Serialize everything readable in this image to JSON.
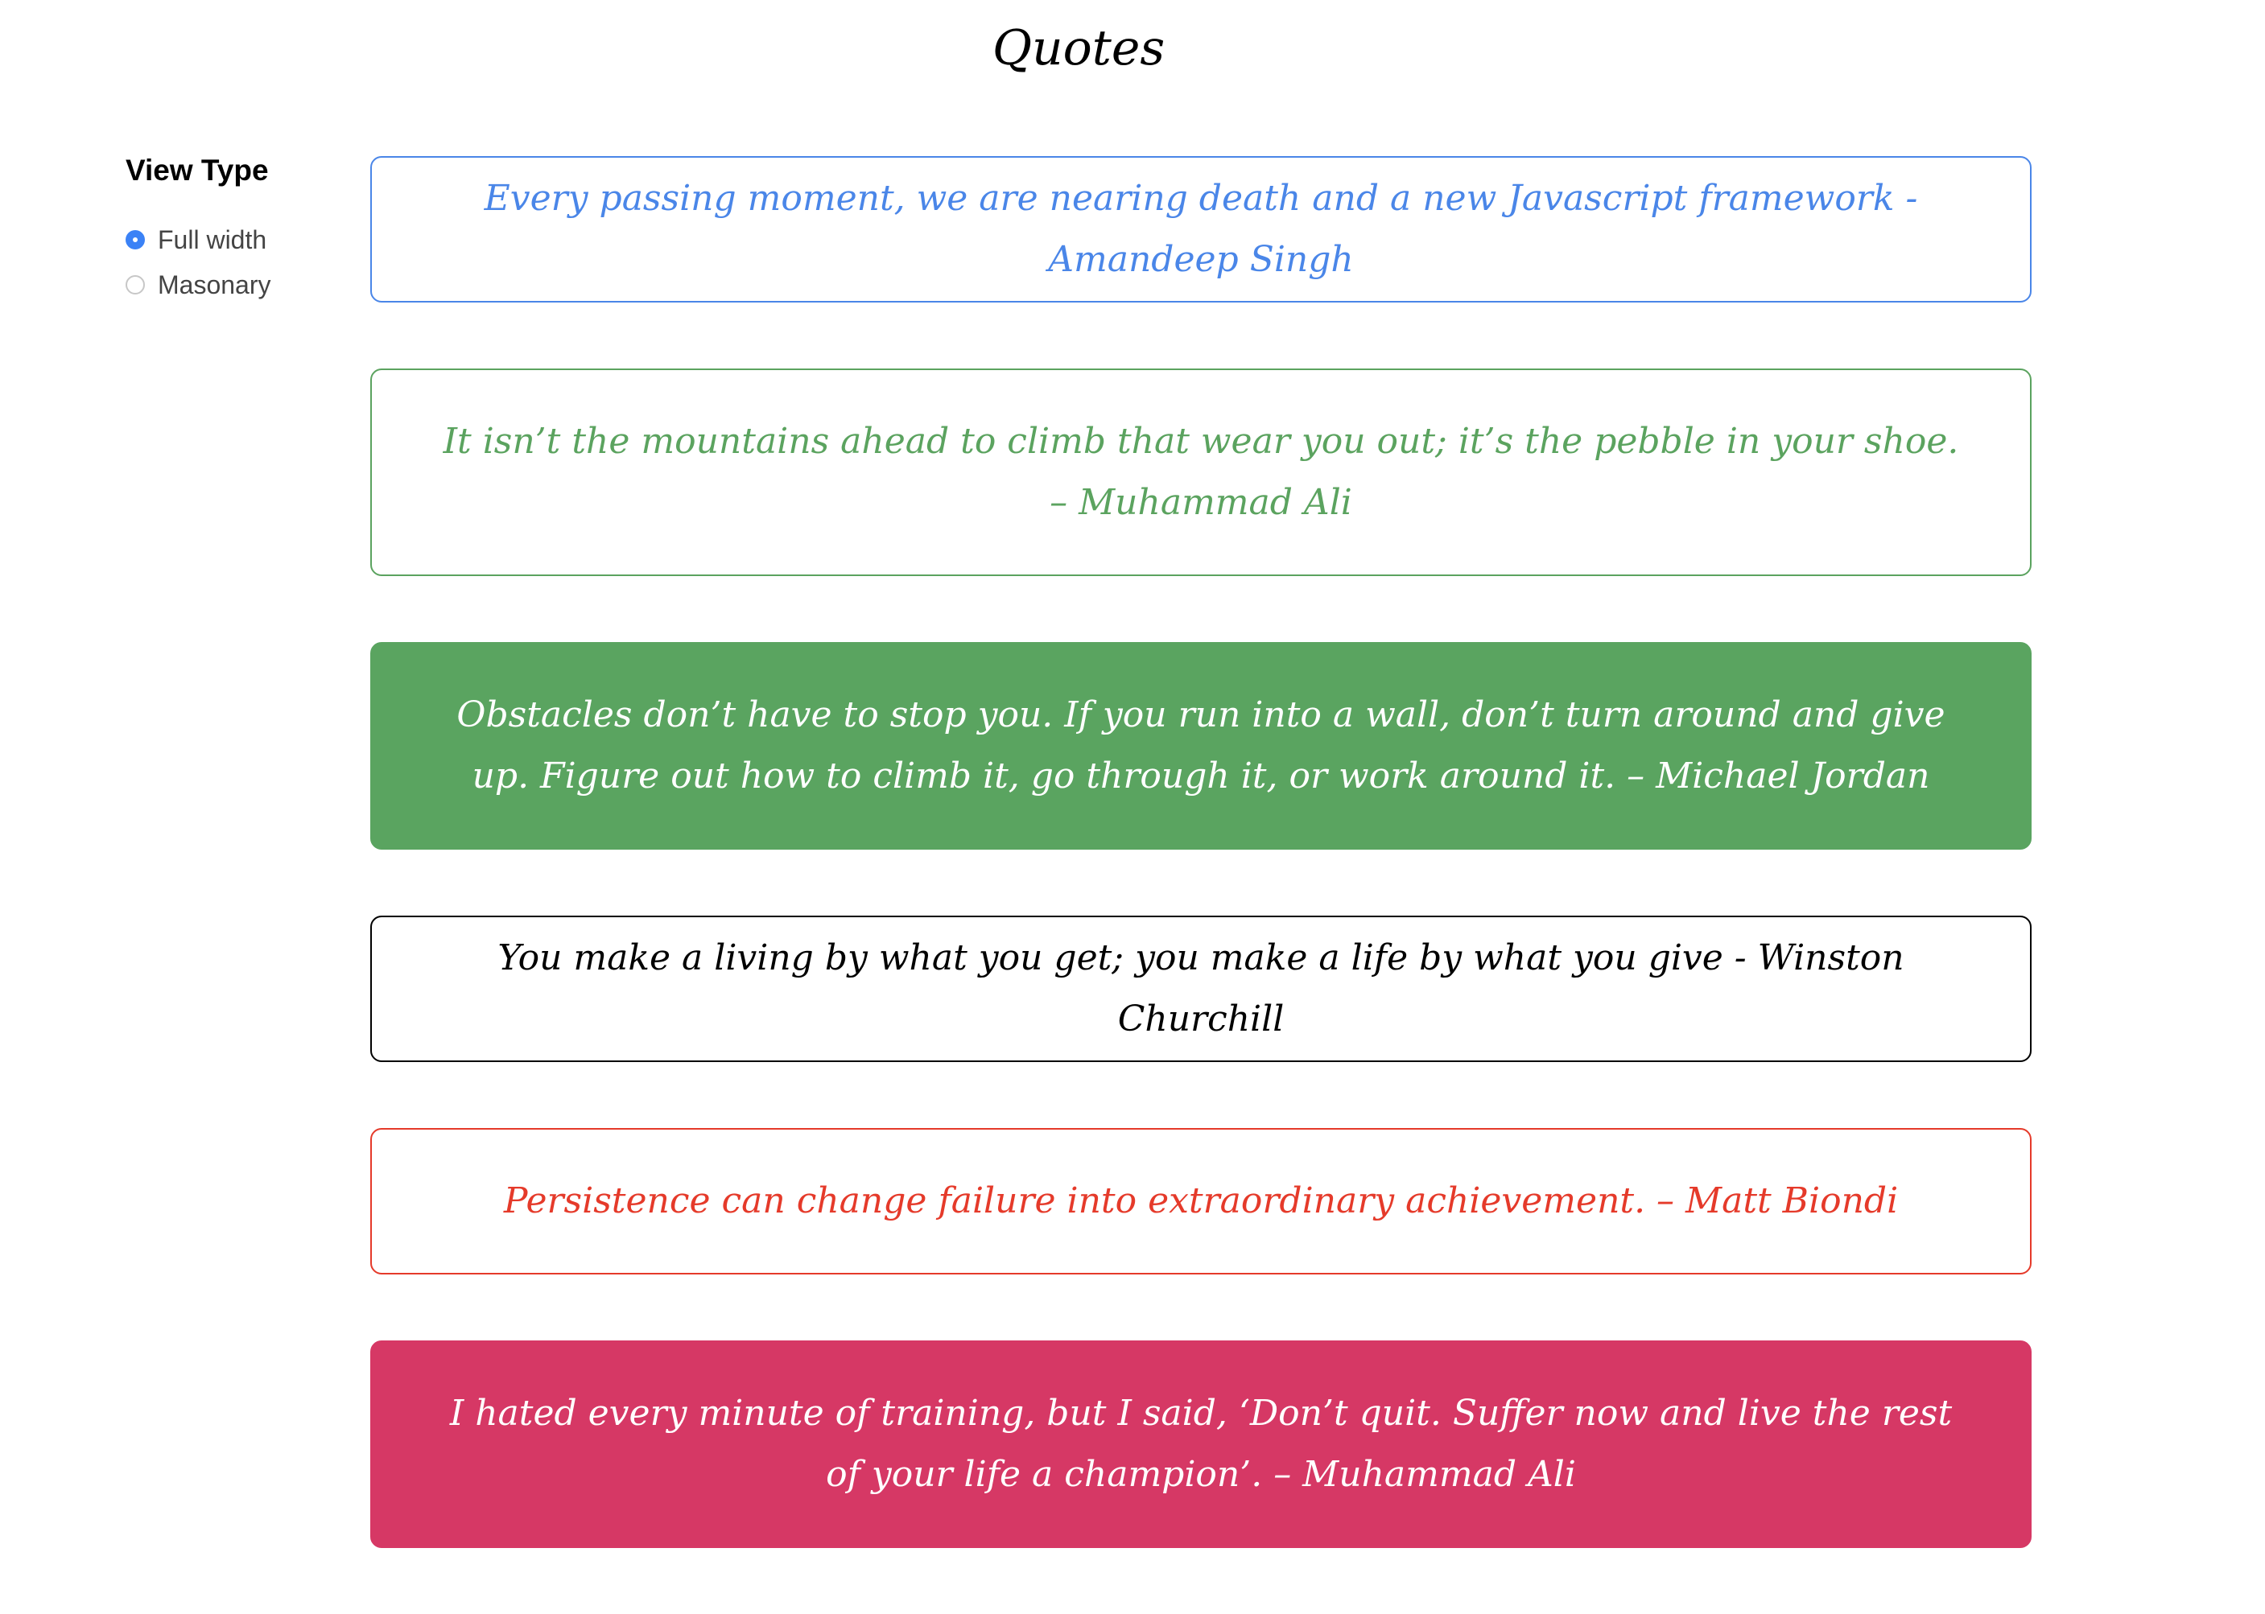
{
  "page": {
    "title": "Quotes"
  },
  "sidebar": {
    "heading": "View Type",
    "options": [
      {
        "label": "Full width",
        "selected": true
      },
      {
        "label": "Masonary",
        "selected": false
      }
    ]
  },
  "quotes": [
    {
      "text": "Every passing moment, we are nearing death and a new Javascript framework - Amandeep Singh",
      "style": "outline",
      "color": "#4a86e8"
    },
    {
      "text": "It isn’t the mountains ahead to climb that wear you out; it’s the pebble in your shoe. – Muhammad Ali",
      "style": "outline",
      "color": "#5ba35f"
    },
    {
      "text": "Obstacles don’t have to stop you. If you run into a wall, don’t turn around and give up. Figure out how to climb it, go through it, or work around it. – Michael Jordan",
      "style": "filled",
      "color": "#5aa460"
    },
    {
      "text": "You make a living by what you get; you make a life by what you give - Winston Churchill",
      "style": "outline",
      "color": "#000000"
    },
    {
      "text": "Persistence can change failure into extraordinary achievement. – Matt Biondi",
      "style": "outline",
      "color": "#e53a2a"
    },
    {
      "text": "I hated every minute of training, but I said, ‘Don’t quit. Suffer now and live the rest of your life a champion’. – Muhammad Ali",
      "style": "filled",
      "color": "#d63865"
    }
  ]
}
